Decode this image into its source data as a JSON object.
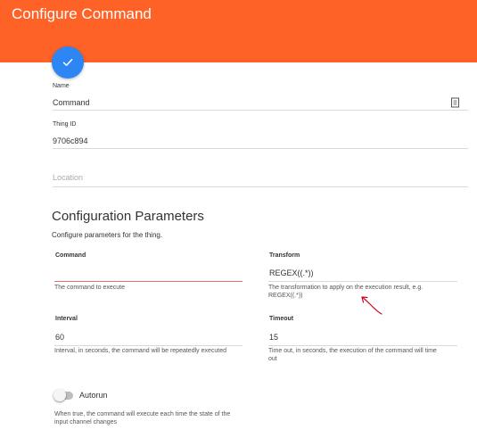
{
  "header": {
    "title": "Configure Command"
  },
  "fab": {
    "icon": "check-icon"
  },
  "fields": {
    "name": {
      "label": "Name",
      "value": "Command"
    },
    "thing_id": {
      "label": "Thing ID",
      "value": "9706c894"
    },
    "location": {
      "placeholder": "Location"
    }
  },
  "config": {
    "title": "Configuration Parameters",
    "subtitle": "Configure parameters for the thing.",
    "command": {
      "label": "Command",
      "value": "",
      "hint": "The command to execute"
    },
    "transform": {
      "label": "Transform",
      "value": "REGEX((.*))",
      "hint_line1": "The transformation to apply on the execution result, e.g.",
      "hint_line2": "REGEX((.*))"
    },
    "interval": {
      "label": "Interval",
      "value": "60",
      "hint": "Interval, in seconds, the command will be repeatedly executed"
    },
    "timeout": {
      "label": "Timeout",
      "value": "15",
      "hint_line1": "Time out, in seconds, the execution of the command will time",
      "hint_line2": "out"
    },
    "autorun": {
      "label": "Autorun",
      "on": false,
      "hint_line1": "When true, the command will execute each time the state of the",
      "hint_line2": "input channel changes"
    }
  },
  "colors": {
    "header": "#fe6227",
    "fab": "#2e86f5",
    "error_line": "#e57373",
    "annotation": "#d0021b"
  }
}
